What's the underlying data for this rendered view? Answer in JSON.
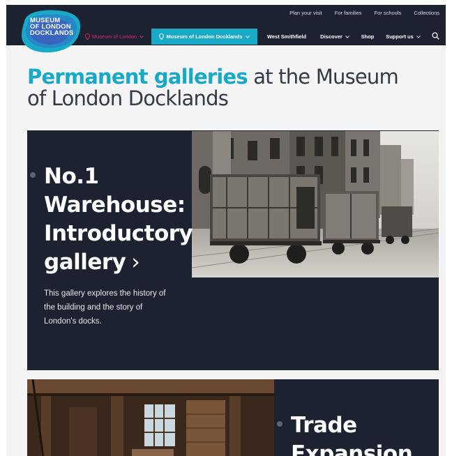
{
  "logo": {
    "line1": "MUSEUM",
    "line2": "OF LONDON",
    "line3": "DOCKLANDS"
  },
  "top_links": [
    "Plan your visit",
    "For families",
    "For schools",
    "Collections"
  ],
  "nav": {
    "museum_of_london": "Museum of London",
    "museum_of_london_docklands": "Museum of London Docklands",
    "west_smithfield": "West Smithfield",
    "discover": "Discover",
    "shop": "Shop",
    "support_us": "Support us"
  },
  "title": {
    "accent": "Permanent galleries",
    "rest": " at the Museum of London Docklands"
  },
  "galleries": [
    {
      "title": "No.1 Warehouse: Introductory gallery",
      "arrow": "›",
      "description": "This gallery explores the history of the building and the story of London's docks."
    },
    {
      "title": "Trade Expansion"
    }
  ],
  "colors": {
    "accent": "#17a9c7",
    "dark": "#1c2230",
    "pink": "#e2246c"
  }
}
